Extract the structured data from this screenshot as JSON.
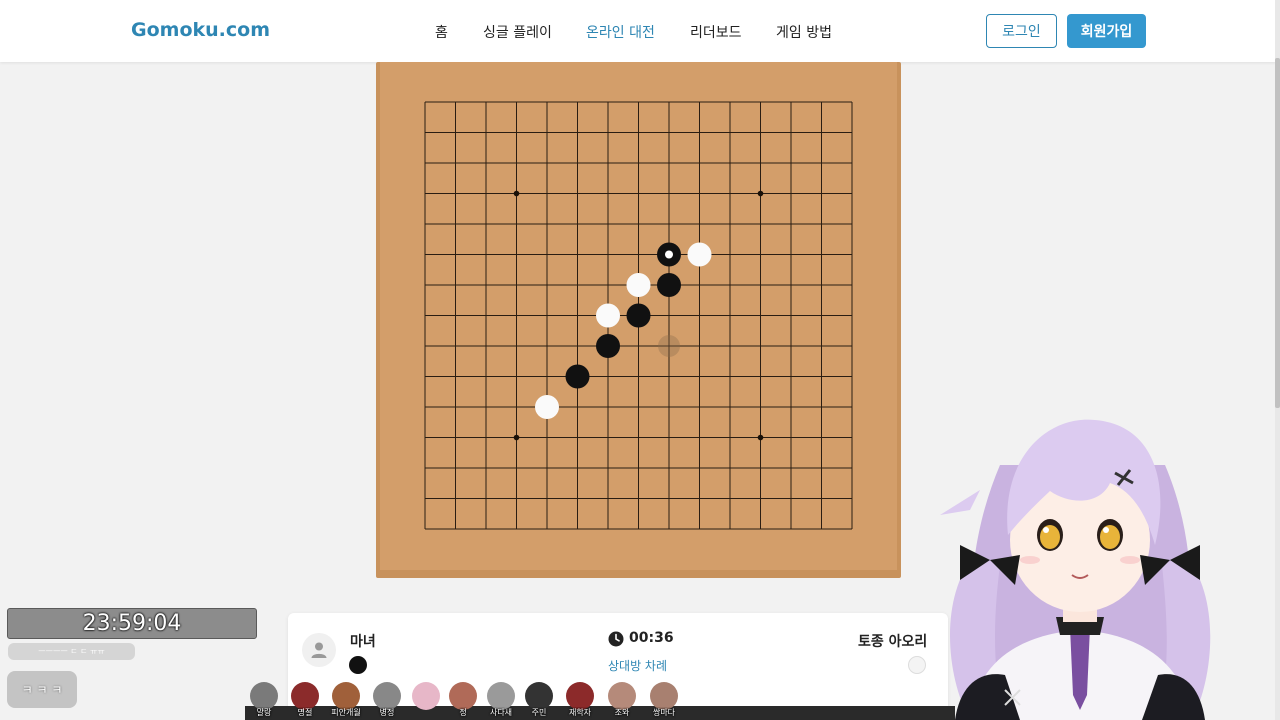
{
  "brand": "Gomoku.com",
  "nav": {
    "home": "홈",
    "single_play": "싱글 플레이",
    "online_match": "온라인 대전",
    "leaderboard": "리더보드",
    "how_to_play": "게임 방법"
  },
  "auth": {
    "login": "로그인",
    "signup": "회원가입"
  },
  "board": {
    "size": 15,
    "star_points": [
      [
        3,
        3
      ],
      [
        3,
        11
      ],
      [
        11,
        3
      ],
      [
        11,
        11
      ]
    ],
    "stones": [
      {
        "col": 8,
        "row": 5,
        "color": "black",
        "last": true
      },
      {
        "col": 9,
        "row": 5,
        "color": "white"
      },
      {
        "col": 7,
        "row": 6,
        "color": "white"
      },
      {
        "col": 8,
        "row": 6,
        "color": "black"
      },
      {
        "col": 6,
        "row": 7,
        "color": "white"
      },
      {
        "col": 7,
        "row": 7,
        "color": "black"
      },
      {
        "col": 6,
        "row": 8,
        "color": "black"
      },
      {
        "col": 5,
        "row": 9,
        "color": "black"
      },
      {
        "col": 4,
        "row": 10,
        "color": "white"
      }
    ],
    "hover": {
      "col": 8,
      "row": 8
    }
  },
  "game": {
    "player1": "마녀",
    "player2": "토종 아오리",
    "timer": "00:36",
    "turn_status": "상대방 차례"
  },
  "overlay": {
    "clock": "23:59:04",
    "chat_small": "ㅡㅡㅡㅡ ㄷ ㄷ ㅠㅠ",
    "chat_bubble": "ㅋ ㅋ ㅋ"
  },
  "viewers": [
    "말랑",
    "명절",
    "피안개월",
    "병정",
    "",
    "정",
    "사다새",
    "주민",
    "재학자",
    "조와",
    "쌍마다"
  ],
  "colors": {
    "accent": "#2e86b3",
    "board": "#d39e6a",
    "board_edge": "#c8925c"
  }
}
